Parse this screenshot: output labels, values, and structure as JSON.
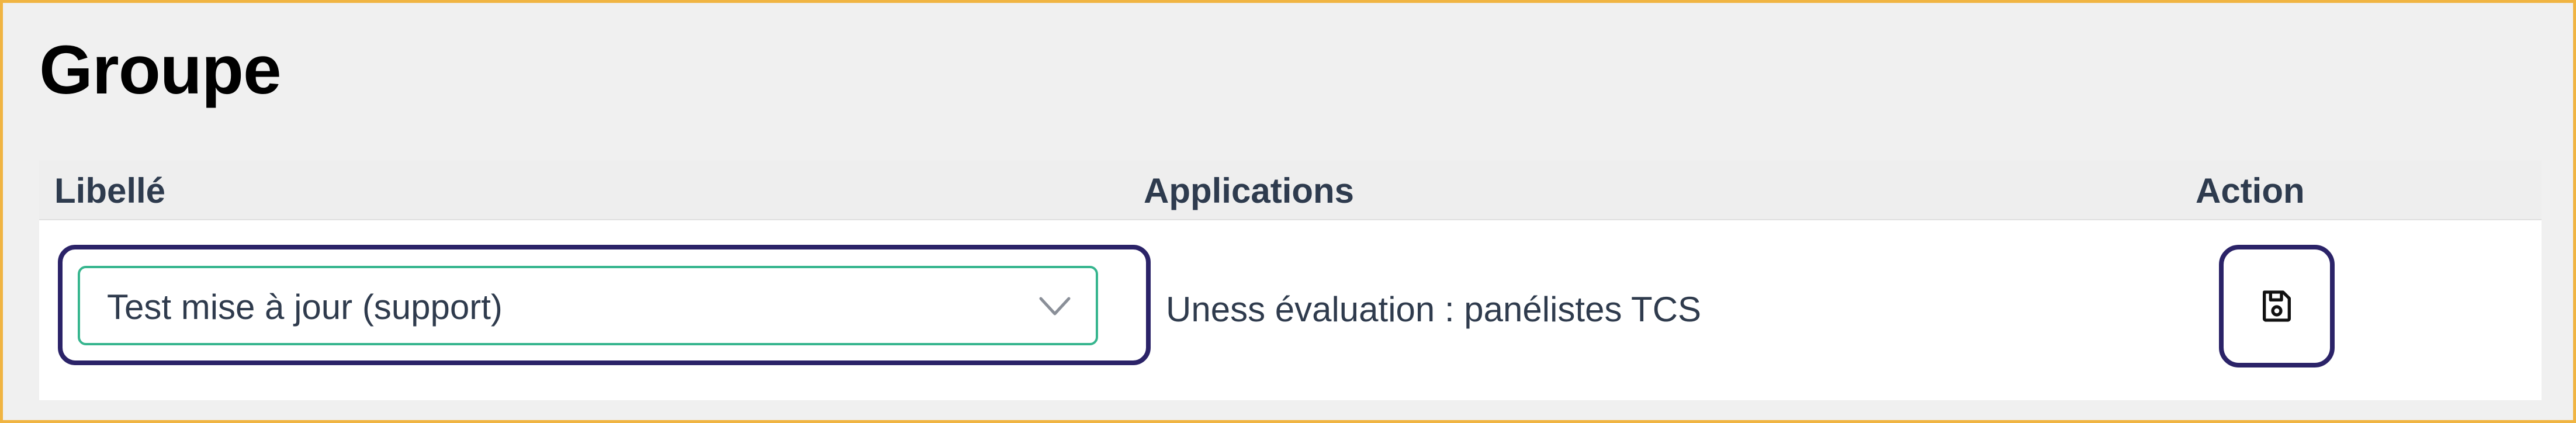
{
  "page": {
    "title": "Groupe"
  },
  "table": {
    "headers": {
      "label": "Libellé",
      "applications": "Applications",
      "action": "Action"
    },
    "rows": [
      {
        "label_select_value": "Test mise à jour (support)",
        "applications": "Uness évaluation : panélistes TCS",
        "action_icon": "save-icon"
      }
    ]
  },
  "colors": {
    "frame_border": "#f0b442",
    "focus_outline": "#2b2368",
    "select_border": "#36b58e",
    "header_text": "#2e3b4e"
  }
}
